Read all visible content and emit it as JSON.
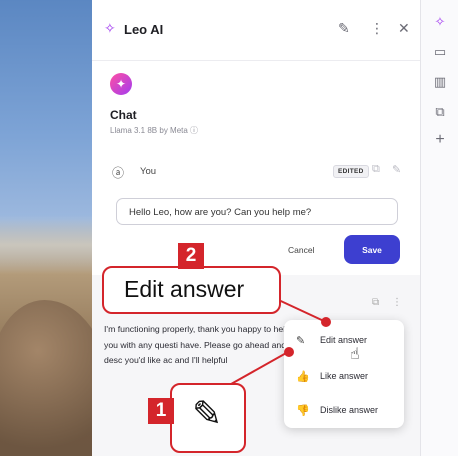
{
  "header": {
    "title": "Leo AI",
    "icons": [
      "leo-logo-icon",
      "new-chat-icon",
      "more-menu-icon",
      "close-icon"
    ],
    "glyphs": {
      "logo": "✧",
      "newchat": "✎",
      "more": "⋮",
      "close": "✕"
    }
  },
  "rail": {
    "glyphs": [
      "✧",
      "▭",
      "▥",
      "⧉",
      "+"
    ]
  },
  "intro": {
    "avatar_glyph": "✦",
    "heading": "Chat",
    "model": "Llama 3.1 8B by Meta ⓘ"
  },
  "user_turn": {
    "icon_glyph": "ⓐ",
    "author": "You",
    "edited_badge": "EDITED",
    "copy_glyph": "⧉",
    "edit_glyph": "✎",
    "input_value": "Hello Leo, how are you? Can you help me?",
    "cancel_label": "Cancel",
    "save_label": "Save"
  },
  "answer": {
    "text": "I'm functioning properly, thank you happy to help you with any questi have. Please go ahead and desc you'd like ac and I'll helpful",
    "copy_glyph": "⧉",
    "more_glyph": "⋮"
  },
  "context_menu": {
    "items": [
      {
        "icon": "✎",
        "label": "Edit answer"
      },
      {
        "icon": "👍",
        "label": "Like answer"
      },
      {
        "icon": "👎",
        "label": "Dislike answer"
      }
    ],
    "cursor_glyph": "☝"
  },
  "callouts": {
    "one_number": "1",
    "one_glyph": "✎",
    "two_number": "2",
    "two_text": "Edit answer"
  },
  "colors": {
    "accent": "#3d3fd0",
    "callout": "#d4252b",
    "brand": "#ff4fa3"
  }
}
